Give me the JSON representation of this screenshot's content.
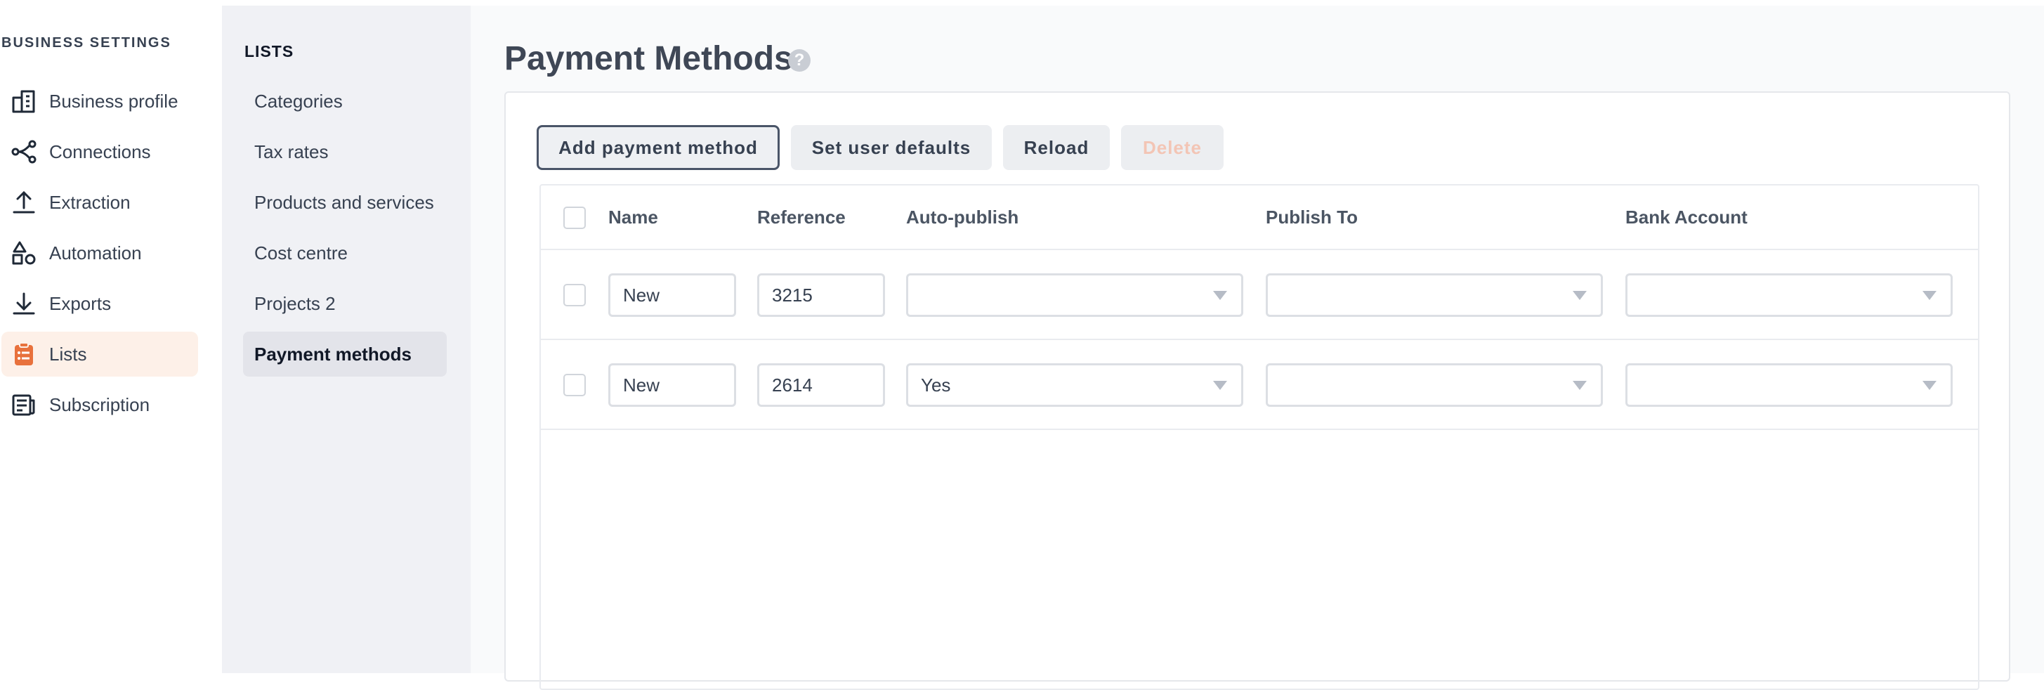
{
  "nav": {
    "heading": "BUSINESS SETTINGS",
    "items": [
      {
        "label": "Business profile",
        "icon": "business-profile-icon"
      },
      {
        "label": "Connections",
        "icon": "connections-icon"
      },
      {
        "label": "Extraction",
        "icon": "extraction-upload-icon"
      },
      {
        "label": "Automation",
        "icon": "automation-shapes-icon"
      },
      {
        "label": "Exports",
        "icon": "exports-download-icon"
      },
      {
        "label": "Lists",
        "icon": "lists-clipboard-icon"
      },
      {
        "label": "Subscription",
        "icon": "subscription-document-icon"
      }
    ],
    "active": "Lists",
    "accent_color": "#e8713c"
  },
  "subnav": {
    "heading": "LISTS",
    "items": [
      "Categories",
      "Tax rates",
      "Products and services",
      "Cost centre",
      "Projects 2",
      "Payment methods"
    ],
    "active": "Payment methods"
  },
  "main": {
    "title": "Payment Methods",
    "help_icon": "?",
    "buttons": {
      "add": "Add payment method",
      "defaults": "Set user defaults",
      "reload": "Reload",
      "delete": "Delete"
    },
    "table": {
      "columns": [
        "Name",
        "Reference",
        "Auto-publish",
        "Publish To",
        "Bank Account"
      ],
      "rows": [
        {
          "name": "New",
          "reference": "3215",
          "auto_publish": "",
          "publish_to": "",
          "bank_account": ""
        },
        {
          "name": "New",
          "reference": "2614",
          "auto_publish": "Yes",
          "publish_to": "",
          "bank_account": ""
        }
      ]
    }
  }
}
